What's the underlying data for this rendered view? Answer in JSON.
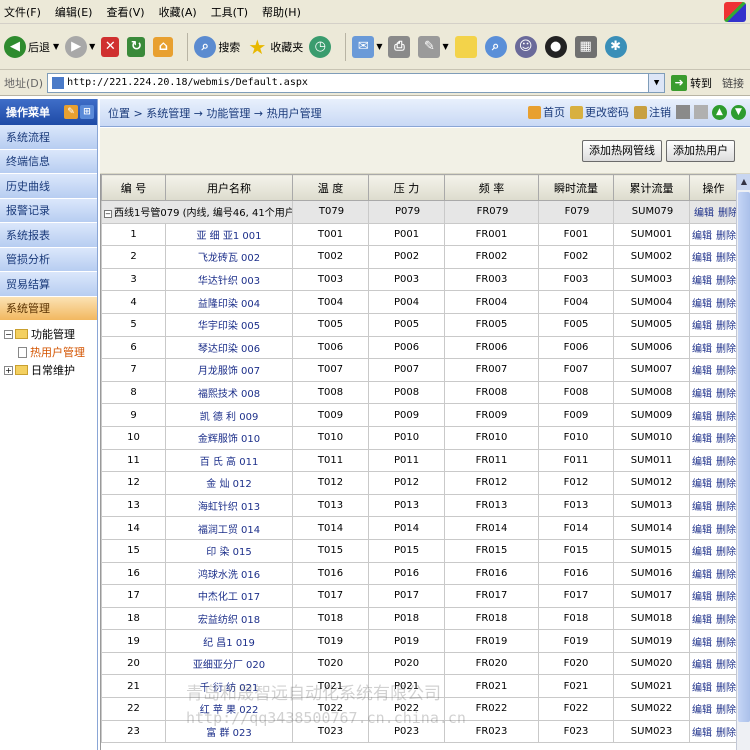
{
  "menubar": {
    "items": [
      "文件(F)",
      "编辑(E)",
      "查看(V)",
      "收藏(A)",
      "工具(T)",
      "帮助(H)"
    ]
  },
  "toolbar": {
    "back": "后退",
    "search": "搜索",
    "favorites": "收藏夹"
  },
  "address": {
    "label": "地址(D)",
    "url": "http://221.224.20.18/webmis/Default.aspx",
    "go": "转到",
    "links": "链接"
  },
  "sidebar": {
    "title": "操作菜单",
    "items": [
      "系统流程",
      "终端信息",
      "历史曲线",
      "报警记录",
      "系统报表",
      "管损分析",
      "贸易结算",
      "系统管理"
    ],
    "tree": {
      "node1": "功能管理",
      "child1": "热用户管理",
      "node2": "日常维护"
    }
  },
  "header": {
    "breadcrumb": "位置 > 系统管理 → 功能管理 → 热用户管理",
    "links": [
      "首页",
      "更改密码",
      "注销"
    ]
  },
  "actions": {
    "add_pipeline": "添加热网管线",
    "add_user": "添加热用户"
  },
  "table": {
    "headers": [
      "编 号",
      "用户名称",
      "温 度",
      "压 力",
      "频 率",
      "瞬时流量",
      "累计流量",
      "操作"
    ],
    "group_label": "西线1号管079  (内线, 编号46, 41个用户)",
    "group_values": [
      "T079",
      "P079",
      "FR079",
      "F079",
      "SUM079"
    ],
    "edit_label": "编辑",
    "delete_label": "删除",
    "rows": [
      [
        "1",
        "亚 细 亚1 001",
        "T001",
        "P001",
        "FR001",
        "F001",
        "SUM001"
      ],
      [
        "2",
        "飞龙砖瓦 002",
        "T002",
        "P002",
        "FR002",
        "F002",
        "SUM002"
      ],
      [
        "3",
        "华达针织 003",
        "T003",
        "P003",
        "FR003",
        "F003",
        "SUM003"
      ],
      [
        "4",
        "益隆印染 004",
        "T004",
        "P004",
        "FR004",
        "F004",
        "SUM004"
      ],
      [
        "5",
        "华宇印染 005",
        "T005",
        "P005",
        "FR005",
        "F005",
        "SUM005"
      ],
      [
        "6",
        "琴达印染 006",
        "T006",
        "P006",
        "FR006",
        "F006",
        "SUM006"
      ],
      [
        "7",
        "月龙服饰 007",
        "T007",
        "P007",
        "FR007",
        "F007",
        "SUM007"
      ],
      [
        "8",
        "福熙技术 008",
        "T008",
        "P008",
        "FR008",
        "F008",
        "SUM008"
      ],
      [
        "9",
        "凯 德 利 009",
        "T009",
        "P009",
        "FR009",
        "F009",
        "SUM009"
      ],
      [
        "10",
        "金辉服饰 010",
        "T010",
        "P010",
        "FR010",
        "F010",
        "SUM010"
      ],
      [
        "11",
        "百 氏 高 011",
        "T011",
        "P011",
        "FR011",
        "F011",
        "SUM011"
      ],
      [
        "12",
        "金 灿 012",
        "T012",
        "P012",
        "FR012",
        "F012",
        "SUM012"
      ],
      [
        "13",
        "海虹针织 013",
        "T013",
        "P013",
        "FR013",
        "F013",
        "SUM013"
      ],
      [
        "14",
        "福润工贸 014",
        "T014",
        "P014",
        "FR014",
        "F014",
        "SUM014"
      ],
      [
        "15",
        "印 染 015",
        "T015",
        "P015",
        "FR015",
        "F015",
        "SUM015"
      ],
      [
        "16",
        "鸿球水洗 016",
        "T016",
        "P016",
        "FR016",
        "F016",
        "SUM016"
      ],
      [
        "17",
        "中杰化工 017",
        "T017",
        "P017",
        "FR017",
        "F017",
        "SUM017"
      ],
      [
        "18",
        "宏益纺织 018",
        "T018",
        "P018",
        "FR018",
        "F018",
        "SUM018"
      ],
      [
        "19",
        "纪 昌1 019",
        "T019",
        "P019",
        "FR019",
        "F019",
        "SUM019"
      ],
      [
        "20",
        "亚细亚分厂 020",
        "T020",
        "P020",
        "FR020",
        "F020",
        "SUM020"
      ],
      [
        "21",
        "千 衍 纺 021",
        "T021",
        "P021",
        "FR021",
        "F021",
        "SUM021"
      ],
      [
        "22",
        "红 苹 果 022",
        "T022",
        "P022",
        "FR022",
        "F022",
        "SUM022"
      ],
      [
        "23",
        "富 群 023",
        "T023",
        "P023",
        "FR023",
        "F023",
        "SUM023"
      ]
    ]
  },
  "watermark": {
    "line1": "青岛和晟智远自动化系统有限公司",
    "line2": "http://qq3438500767.cn.china.cn"
  }
}
